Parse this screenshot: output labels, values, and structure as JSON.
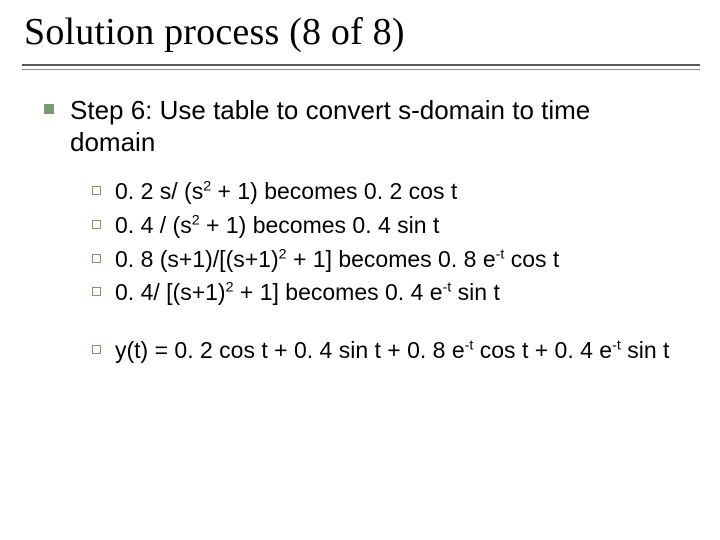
{
  "title": "Solution process (8 of 8)",
  "step": {
    "heading": "Step 6: Use table to convert s-domain to time domain"
  },
  "items": {
    "a": {
      "pre": "0. 2 s/ (s",
      "sup1": "2",
      "mid": " + 1) becomes 0. 2 cos t"
    },
    "b": {
      "pre": "0. 4  / (s",
      "sup1": "2",
      "mid": " + 1) becomes 0. 4 sin t"
    },
    "c": {
      "pre": "0. 8 (s+1)/[(s+1)",
      "sup1": "2",
      "mid": " + 1]  becomes 0. 8 e",
      "sup2": "-t",
      "post": " cos t"
    },
    "d": {
      "pre": "0. 4/ [(s+1)",
      "sup1": "2",
      "mid": " + 1] becomes 0. 4 e",
      "sup2": "-t",
      "post": " sin t"
    }
  },
  "result": {
    "p1": "y(t) = 0. 2 cos t + 0. 4 sin t + 0. 8 e",
    "s1": "-t",
    "p2": " cos t + 0. 4 e",
    "s2": "-t",
    "p3": " sin t"
  }
}
